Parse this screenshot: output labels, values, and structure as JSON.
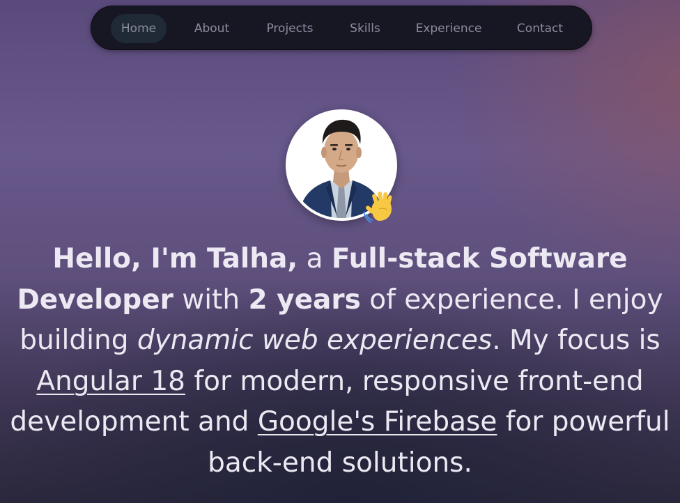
{
  "nav": {
    "items": [
      {
        "label": "Home",
        "active": true
      },
      {
        "label": "About",
        "active": false
      },
      {
        "label": "Projects",
        "active": false
      },
      {
        "label": "Skills",
        "active": false
      },
      {
        "label": "Experience",
        "active": false
      },
      {
        "label": "Contact",
        "active": false
      }
    ]
  },
  "hero": {
    "avatar_icon": "profile-photo",
    "badge_icon": "waving-hand-icon",
    "intro": {
      "greeting": "Hello, I'm Talha,",
      "a": " a ",
      "role": "Full-stack Software Developer",
      "with": " with ",
      "years": "2 years",
      "of_exp": " of experience. I enjoy building ",
      "dynamic": "dynamic web experiences",
      "focus": ". My focus is ",
      "angular_link": "Angular 18",
      "front": " for modern, responsive front-end development and ",
      "firebase_link": "Google's Firebase",
      "back": " for powerful back-end solutions."
    }
  },
  "colors": {
    "nav_bg": "#171724",
    "nav_active_bg": "#1f2a36",
    "nav_text": "#8b8c9e",
    "text": "#ece9f3"
  }
}
